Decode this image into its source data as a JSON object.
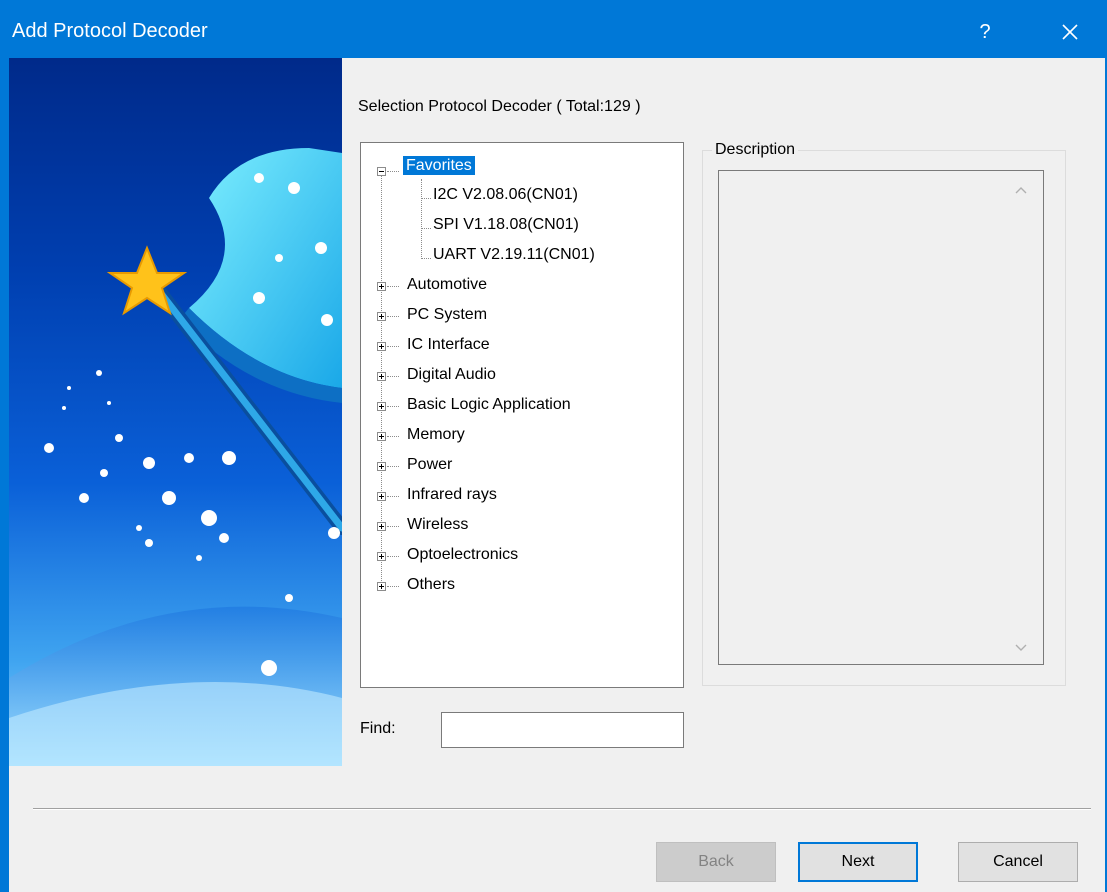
{
  "window": {
    "title": "Add Protocol Decoder",
    "help_label": "?",
    "close_label": "✕"
  },
  "main": {
    "selection_label": "Selection Protocol Decoder ( Total:129 )",
    "description_label": "Description",
    "find_label": "Find:",
    "find_value": ""
  },
  "tree": {
    "favorites": {
      "label": "Favorites",
      "children": [
        "I2C V2.08.06(CN01)",
        "SPI V1.18.08(CN01)",
        "UART V2.19.11(CN01)"
      ]
    },
    "categories": [
      "Automotive",
      "PC System",
      "IC Interface",
      "Digital Audio",
      "Basic Logic Application",
      "Memory",
      "Power",
      "Infrared rays",
      "Wireless",
      "Optoelectronics",
      "Others"
    ]
  },
  "buttons": {
    "back": "Back",
    "next": "Next",
    "cancel": "Cancel"
  },
  "scrollbar": {
    "up": "⌃",
    "down": "⌄"
  },
  "colors": {
    "titlebar": "#0078d7",
    "selection": "#0078d7"
  }
}
